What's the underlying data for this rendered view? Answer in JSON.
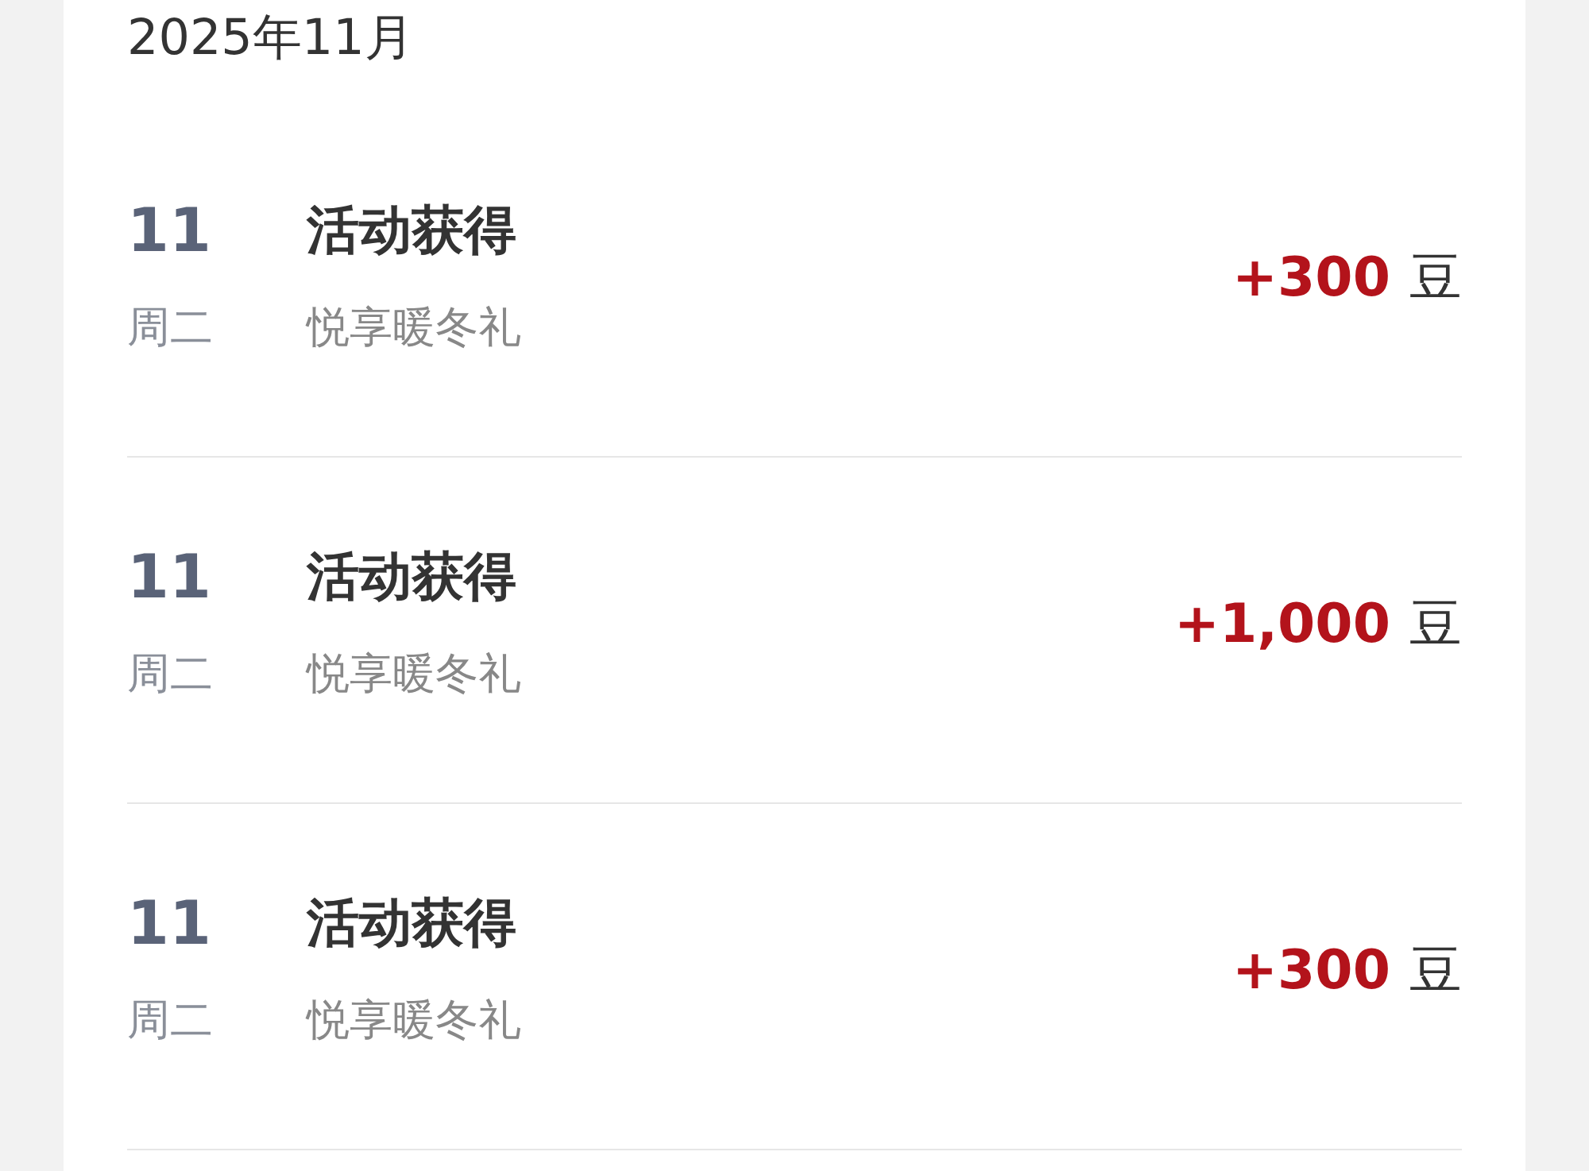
{
  "month": "2025年11月",
  "records": [
    {
      "day": "11",
      "weekday": "周二",
      "title": "活动获得",
      "subtitle": "悦享暖冬礼",
      "amount": "+300",
      "unit": "豆"
    },
    {
      "day": "11",
      "weekday": "周二",
      "title": "活动获得",
      "subtitle": "悦享暖冬礼",
      "amount": "+1,000",
      "unit": "豆"
    },
    {
      "day": "11",
      "weekday": "周二",
      "title": "活动获得",
      "subtitle": "悦享暖冬礼",
      "amount": "+300",
      "unit": "豆"
    }
  ]
}
